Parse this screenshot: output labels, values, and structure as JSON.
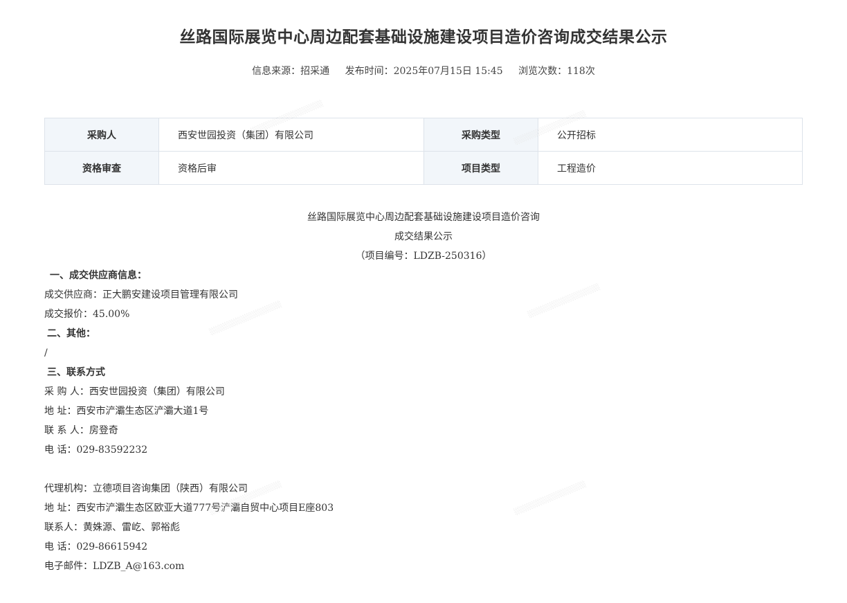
{
  "title": "丝路国际展览中心周边配套基础设施建设项目造价咨询成交结果公示",
  "meta": {
    "source": "信息来源：招采通",
    "publish_time": "发布时间：2025年07月15日 15:45",
    "views": "浏览次数：118次"
  },
  "table": {
    "rows": [
      {
        "label1": "采购人",
        "value1": "西安世园投资（集团）有限公司",
        "label2": "采购类型",
        "value2": "公开招标"
      },
      {
        "label1": "资格审查",
        "value1": "资格后审",
        "label2": "项目类型",
        "value2": "工程造价"
      }
    ]
  },
  "body": {
    "heading_line1": "丝路国际展览中心周边配套基础设施建设项目造价咨询",
    "heading_line2": "成交结果公示",
    "project_no": "（项目编号：LDZB-250316）",
    "section1_title": "一、成交供应商信息：",
    "supplier": "成交供应商：正大鹏安建设项目管理有限公司",
    "price": "成交报价：45.00%",
    "section2_title": "二、其他：",
    "other": "/",
    "section3_title": "三、联系方式",
    "buyer": "采 购 人：西安世园投资（集团）有限公司",
    "buyer_address": "地 址：西安市浐灞生态区浐灞大道1号",
    "buyer_contact": "联 系 人：房登奇",
    "buyer_phone": "电 话：029-83592232",
    "agency": "代理机构：立德项目咨询集团（陕西）有限公司",
    "agency_address": "地 址：西安市浐灞生态区欧亚大道777号浐灞自贸中心项目E座803",
    "agency_contact": "联系人：黄姝源、雷屹、郭裕彪",
    "agency_phone": "电 话：029-86615942",
    "agency_email": "电子邮件：LDZB_A@163.com"
  }
}
